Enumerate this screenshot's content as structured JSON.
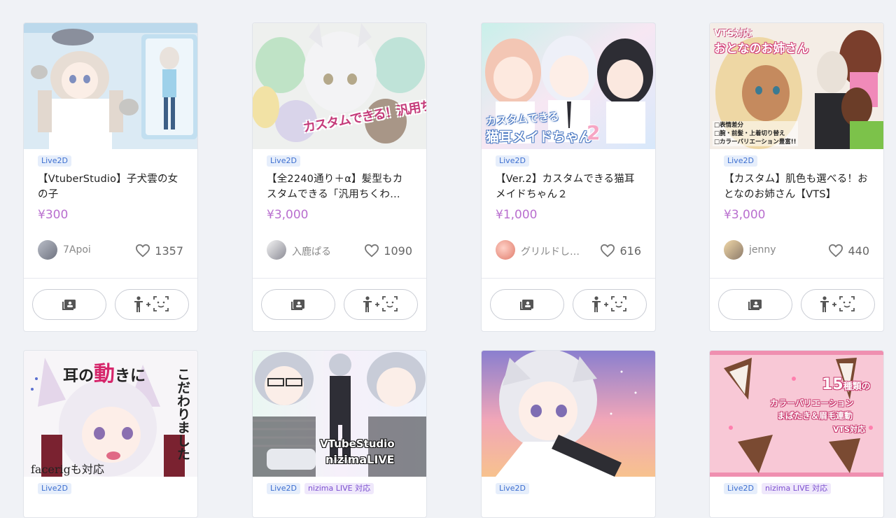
{
  "products": [
    {
      "tags": [
        "Live2D"
      ],
      "title": "【VtuberStudio】子犬雲の女の子",
      "price": "¥300",
      "creator": "7Apoi",
      "likes": "1357"
    },
    {
      "tags": [
        "Live2D"
      ],
      "title": "【全2240通り＋α】髪型もカスタムできる「汎用ちくわ…",
      "price": "¥3,000",
      "creator": "入鹿ぱる",
      "likes": "1090"
    },
    {
      "tags": [
        "Live2D"
      ],
      "title": "【Ver.2】カスタムできる猫耳メイドちゃん２",
      "price": "¥1,000",
      "creator": "グリルドし…",
      "likes": "616"
    },
    {
      "tags": [
        "Live2D"
      ],
      "title": "【カスタム】肌色も選べる！おとなのお姉さん【VTS】",
      "price": "¥3,000",
      "creator": "jenny",
      "likes": "440"
    },
    {
      "tags": [
        "Live2D"
      ]
    },
    {
      "tags": [
        "Live2D",
        "nizima LIVE 対応"
      ]
    },
    {
      "tags": [
        "Live2D"
      ]
    },
    {
      "tags": [
        "Live2D",
        "nizima LIVE 対応"
      ]
    }
  ],
  "thumb_text": {
    "t2": "カスタムできる！汎用ちくわちゃん",
    "t3a": "カスタムできる",
    "t3b": "猫耳メイドちゃん",
    "t3c": "2",
    "t4a": "VTS対応",
    "t4b": "おとなのお姉さん",
    "t4c": "□表情差分",
    "t4d": "□腕・前髪・上着切り替え",
    "t4e": "□カラーバリエーション豊富!!",
    "t5a": "耳の",
    "t5b": "動",
    "t5c": "きに",
    "t5d": "こだわりました",
    "t5e": "facerigも対応",
    "t6a": "VTubeStudio",
    "t6b": "nizimaLIVE",
    "t8a": "15",
    "t8b": "種類の",
    "t8c": "カラーバリエーション",
    "t8d": "まばたき＆眉毛連動",
    "t8e": "VTS対応"
  }
}
